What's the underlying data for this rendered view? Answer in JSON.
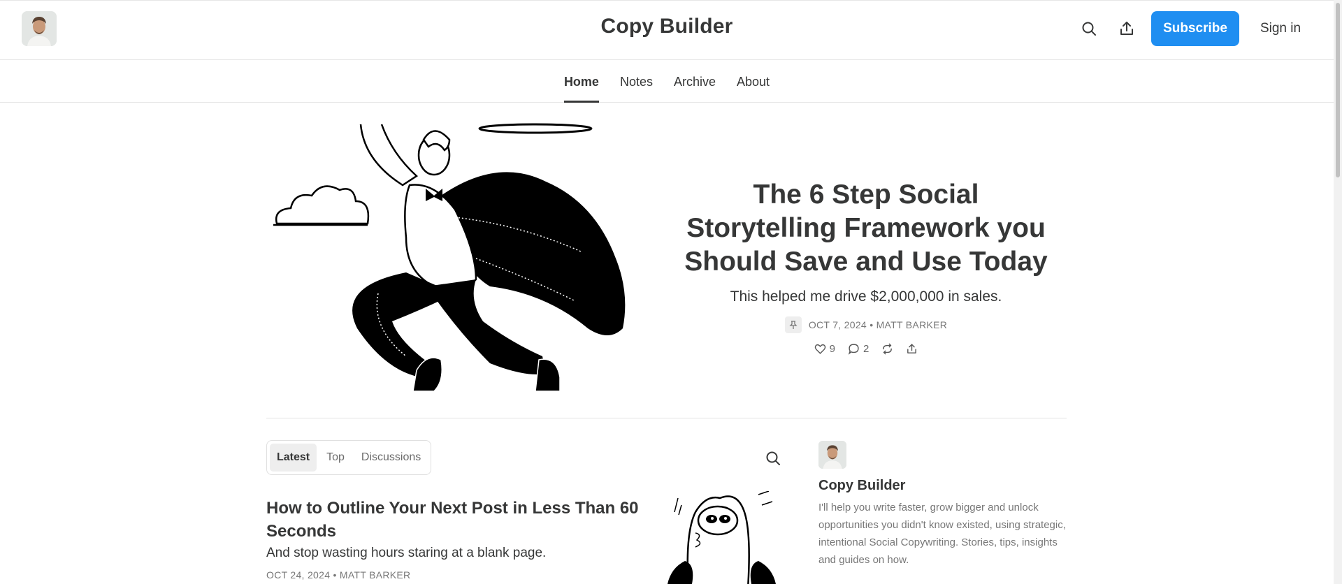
{
  "header": {
    "site_title": "Copy Builder",
    "subscribe_label": "Subscribe",
    "signin_label": "Sign in",
    "accent_color": "#1f8ef1"
  },
  "nav": {
    "items": [
      {
        "label": "Home",
        "active": true
      },
      {
        "label": "Notes",
        "active": false
      },
      {
        "label": "Archive",
        "active": false
      },
      {
        "label": "About",
        "active": false
      }
    ]
  },
  "hero": {
    "title": "The 6 Step Social Storytelling Framework you Should Save and Use Today",
    "subtitle": "This helped me drive $2,000,000 in sales.",
    "meta": "OCT 7, 2024 • MATT BARKER",
    "likes": "9",
    "comments": "2"
  },
  "feed": {
    "tabs": [
      {
        "label": "Latest",
        "active": true
      },
      {
        "label": "Top",
        "active": false
      },
      {
        "label": "Discussions",
        "active": false
      }
    ],
    "posts": [
      {
        "title": "How to Outline Your Next Post in Less Than 60 Seconds",
        "subtitle": "And stop wasting hours staring at a blank page.",
        "meta": "OCT 24, 2024 • MATT BARKER"
      }
    ]
  },
  "sidebar": {
    "title": "Copy Builder",
    "description": "I'll help you write faster, grow bigger and unlock opportunities you didn't know existed, using strategic, intentional Social Copywriting. Stories, tips, insights and guides on how."
  }
}
